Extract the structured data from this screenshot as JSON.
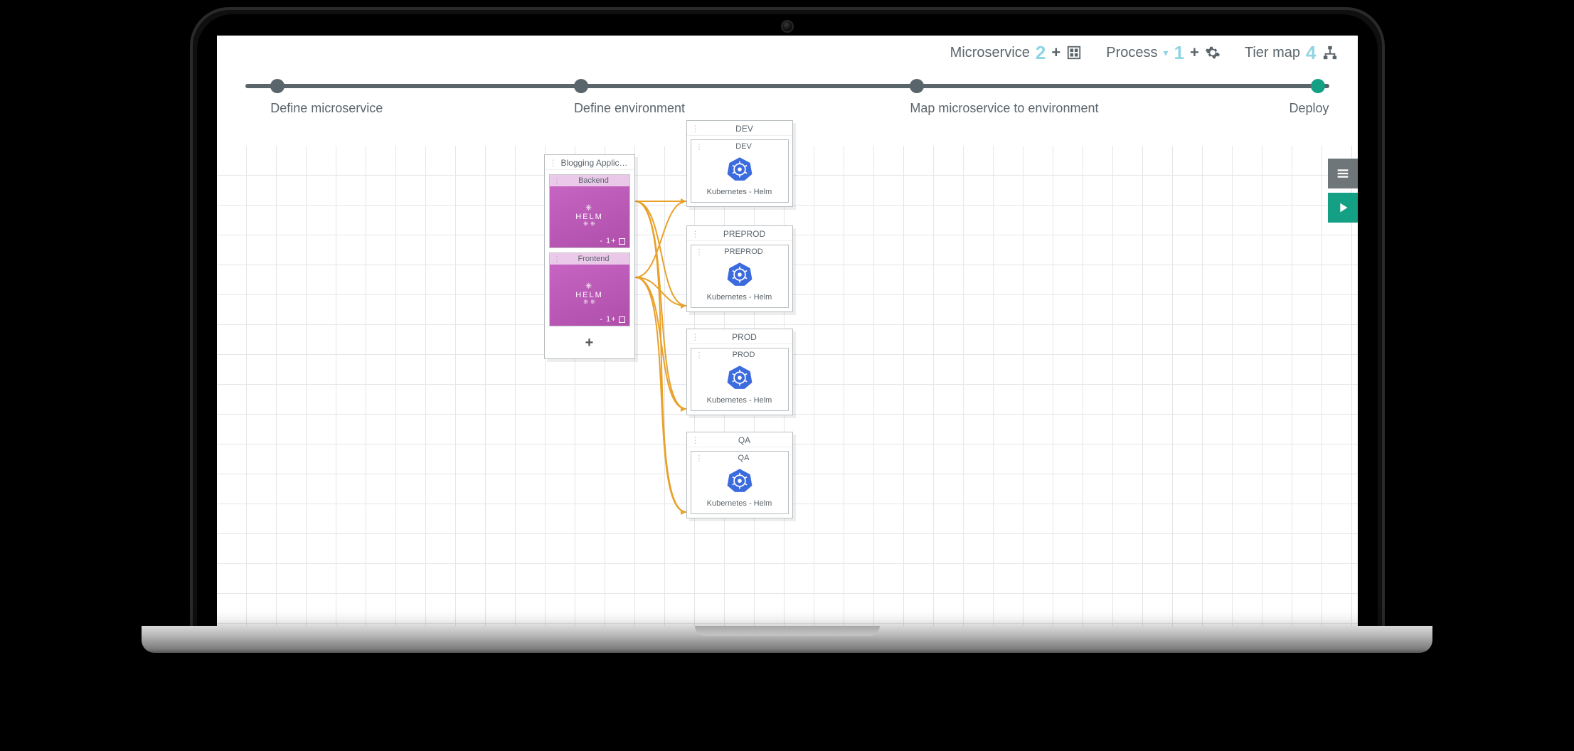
{
  "topbar": {
    "microservice": {
      "label": "Microservice",
      "count": "2"
    },
    "process": {
      "label": "Process",
      "count": "1"
    },
    "tiermap": {
      "label": "Tier map",
      "count": "4"
    }
  },
  "stepper": {
    "steps": [
      {
        "label": "Define microservice",
        "pos": 3
      },
      {
        "label": "Define environment",
        "pos": 31
      },
      {
        "label": "Map microservice to environment",
        "pos": 62
      },
      {
        "label": "Deploy",
        "pos": 99
      }
    ],
    "active": 3
  },
  "ms_group": {
    "title": "Blogging Applic…",
    "cards": [
      {
        "name": "Backend",
        "tech": "HELM",
        "footer": "- 1+"
      },
      {
        "name": "Frontend",
        "tech": "HELM",
        "footer": "- 1+"
      }
    ],
    "add": "+"
  },
  "environments": [
    {
      "group": "DEV",
      "name": "DEV",
      "platform": "Kubernetes - Helm"
    },
    {
      "group": "PREPROD",
      "name": "PREPROD",
      "platform": "Kubernetes - Helm"
    },
    {
      "group": "PROD",
      "name": "PROD",
      "platform": "Kubernetes - Helm"
    },
    {
      "group": "QA",
      "name": "QA",
      "platform": "Kubernetes - Helm"
    }
  ],
  "env_add": "+"
}
